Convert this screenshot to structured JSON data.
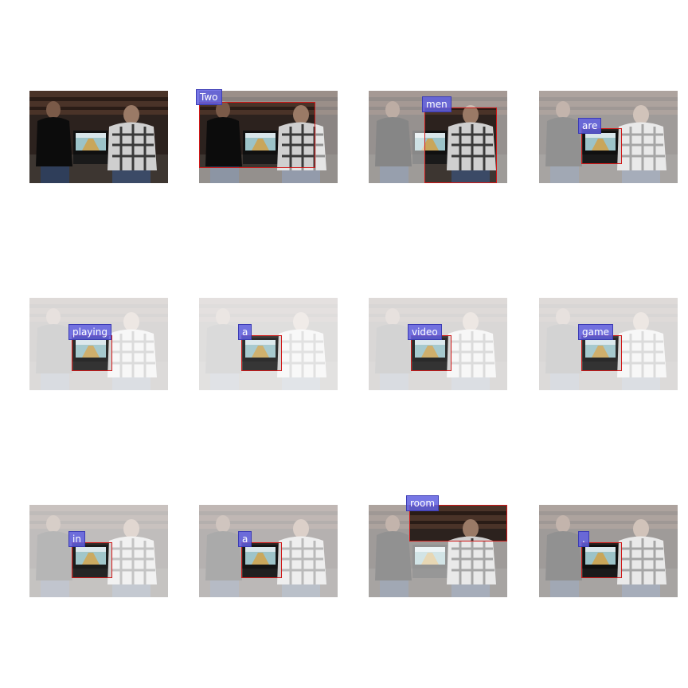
{
  "caption_tokens": [
    {
      "word": "",
      "kind": "original"
    },
    {
      "word": "Two",
      "kind": "attention"
    },
    {
      "word": "men",
      "kind": "attention"
    },
    {
      "word": "are",
      "kind": "attention"
    },
    {
      "word": "playing",
      "kind": "attention"
    },
    {
      "word": "a",
      "kind": "attention"
    },
    {
      "word": "video",
      "kind": "attention"
    },
    {
      "word": "game",
      "kind": "attention"
    },
    {
      "word": "in",
      "kind": "attention"
    },
    {
      "word": "a",
      "kind": "attention"
    },
    {
      "word": "room",
      "kind": "attention"
    },
    {
      "word": ".",
      "kind": "attention"
    }
  ],
  "colors": {
    "box_border": "#d01818",
    "tag_fill": "#5f5fe1",
    "tag_text": "#ffffff"
  }
}
